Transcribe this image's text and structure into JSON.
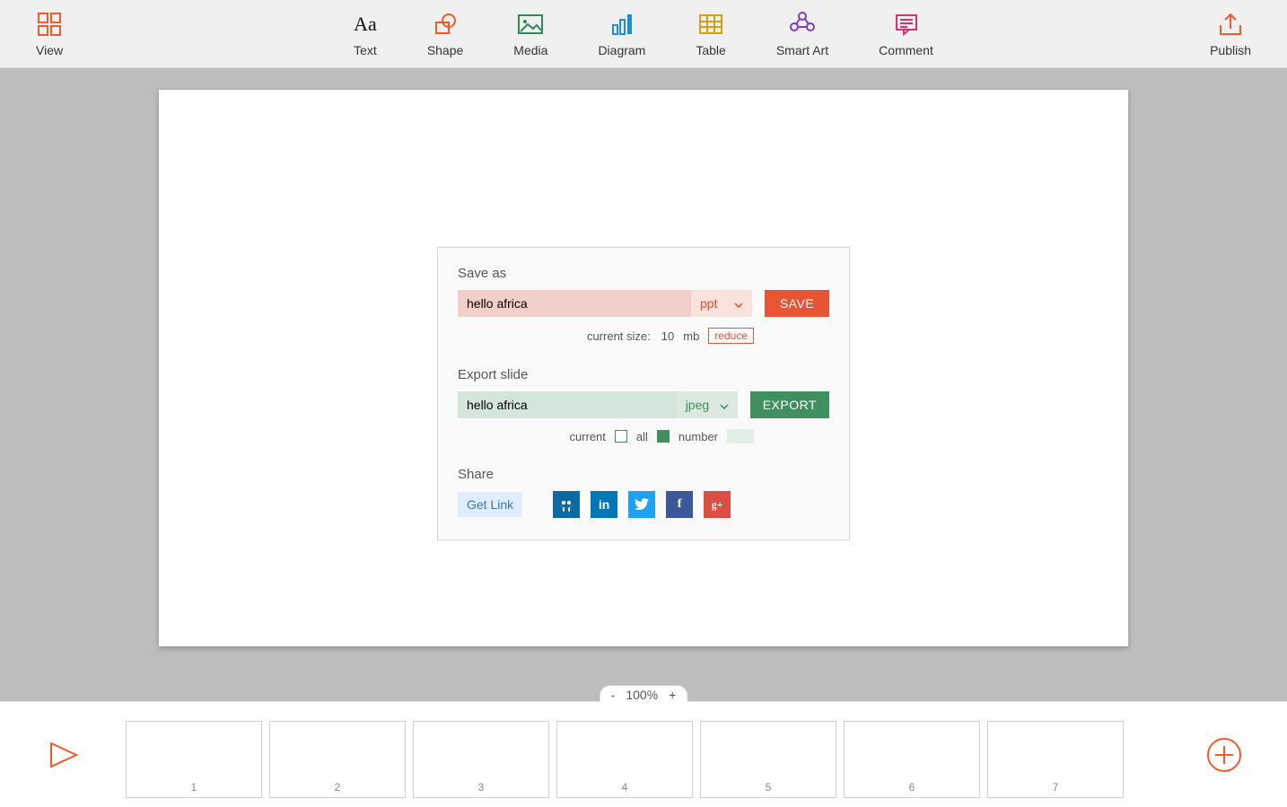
{
  "toolbar": {
    "left": {
      "view_label": "View"
    },
    "center": {
      "text_label": "Text",
      "shape_label": "Shape",
      "media_label": "Media",
      "diagram_label": "Diagram",
      "table_label": "Table",
      "smartart_label": "Smart Art",
      "comment_label": "Comment"
    },
    "right": {
      "publish_label": "Publish"
    }
  },
  "zoom": {
    "minus": "-",
    "value": "100%",
    "plus": "+"
  },
  "publish": {
    "saveas": {
      "title": "Save as",
      "filename": "hello africa",
      "format": "ppt",
      "save_label": "SAVE",
      "size_label": "current size:",
      "size_value": "10",
      "size_unit": "mb",
      "reduce_label": "reduce"
    },
    "export": {
      "title": "Export slide",
      "filename": "hello africa",
      "format": "jpeg",
      "export_label": "EXPORT",
      "current_label": "current",
      "all_label": "all",
      "number_label": "number"
    },
    "share": {
      "title": "Share",
      "getlink_label": "Get Link"
    }
  },
  "slides": [
    "1",
    "2",
    "3",
    "4",
    "5",
    "6",
    "7"
  ]
}
